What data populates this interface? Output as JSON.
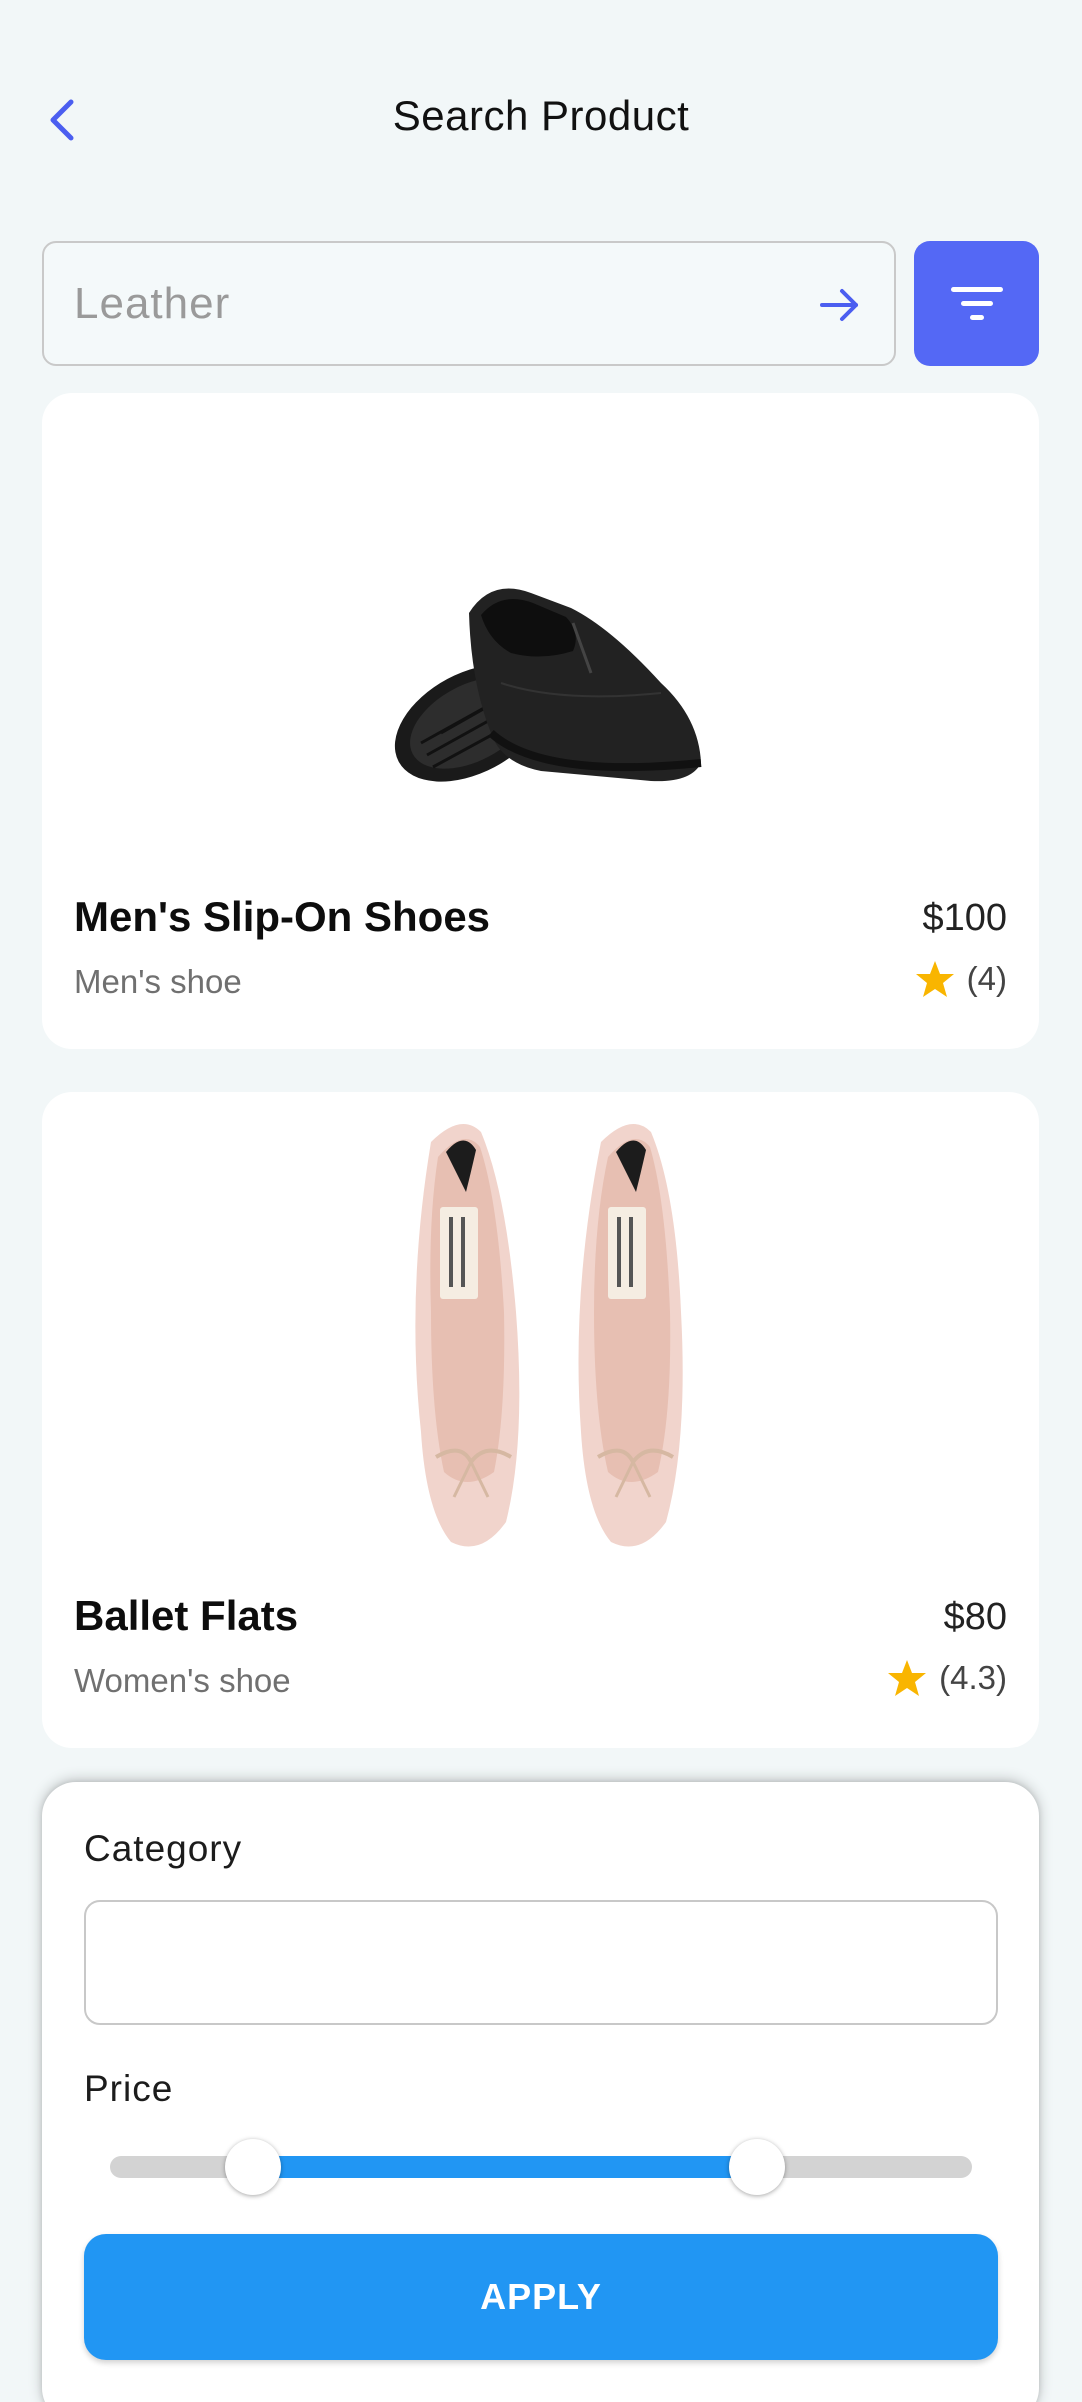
{
  "header": {
    "title": "Search Product",
    "back_icon": "chevron-left-icon"
  },
  "search": {
    "placeholder": "Leather",
    "value": "",
    "submit_icon": "arrow-right-icon",
    "filter_icon": "filter-icon"
  },
  "colors": {
    "accent": "#5468f5",
    "primary": "#2196f3",
    "star": "#f9b500",
    "background": "#f2f7f8"
  },
  "products": [
    {
      "name": "Men's Slip-On Shoes",
      "category": "Men's shoe",
      "price": "$100",
      "rating": "(4)",
      "image": "slip-on-shoe-image"
    },
    {
      "name": "Ballet Flats",
      "category": "Women's shoe",
      "price": "$80",
      "rating": "(4.3)",
      "image": "ballet-flats-image"
    }
  ],
  "filter": {
    "category_label": "Category",
    "category_value": "",
    "price_label": "Price",
    "price_range": {
      "low": 0.166,
      "high": 0.75
    },
    "apply_label": "APPLY"
  }
}
